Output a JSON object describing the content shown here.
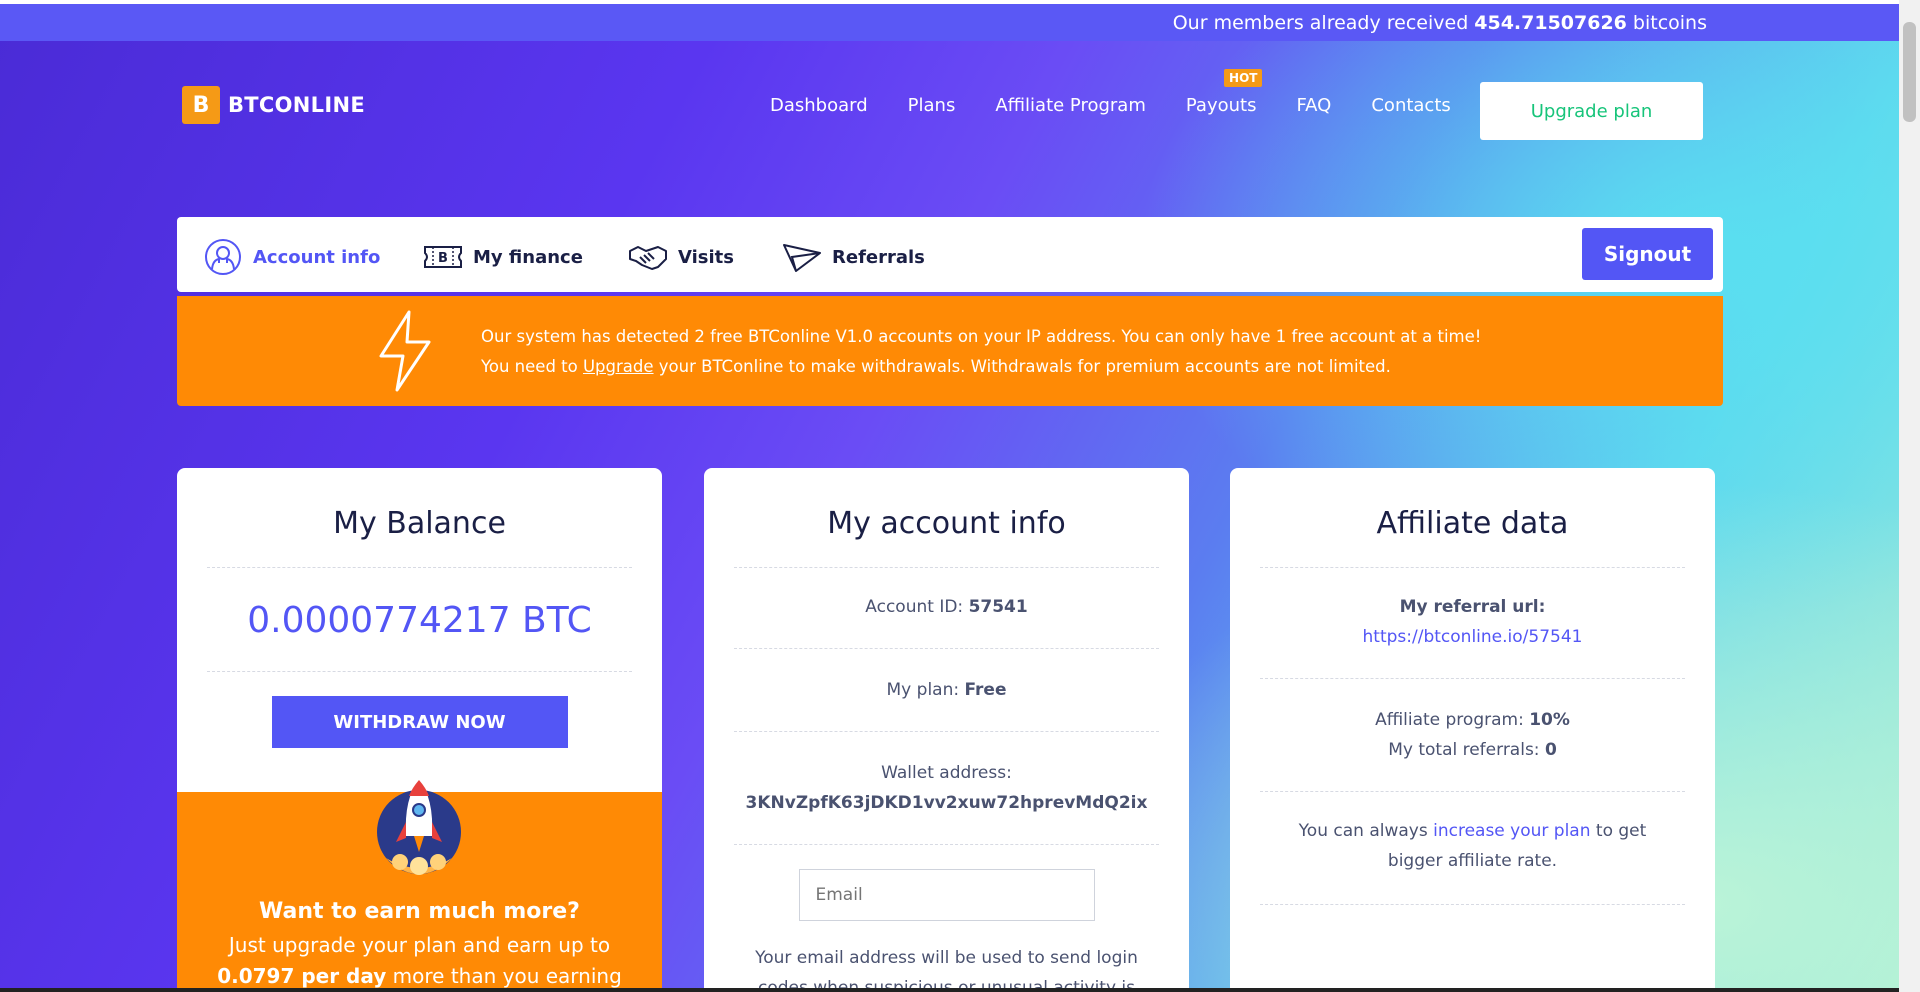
{
  "topbar": {
    "prefix": "Our members already received",
    "amount": "454.71507626",
    "suffix": "bitcoins"
  },
  "brand": {
    "mark": "B",
    "name": "BTCONLINE"
  },
  "nav": {
    "items": [
      "Dashboard",
      "Plans",
      "Affiliate Program",
      "Payouts",
      "FAQ",
      "Contacts"
    ],
    "hot_badge": "HOT",
    "upgrade_label": "Upgrade plan"
  },
  "tabs": {
    "items": [
      "Account info",
      "My finance",
      "Visits",
      "Referrals"
    ],
    "signout_label": "Signout"
  },
  "alert": {
    "line1": "Our system has detected 2 free BTConline V1.0 accounts on your IP address. You can only have 1 free account at a time!",
    "line2_prefix": "You need to",
    "line2_link": "Upgrade",
    "line2_suffix": "your BTConline to make withdrawals. Withdrawals for premium accounts are not limited."
  },
  "balance_card": {
    "title": "My Balance",
    "balance": "0.0000774217 BTC",
    "withdraw_label": "WITHDRAW NOW",
    "promo_title": "Want to earn much more?",
    "promo_prefix": "Just upgrade your plan and earn up to",
    "promo_amount": "0.0797 per day",
    "promo_suffix": "more than you earning now!"
  },
  "account_card": {
    "title": "My account info",
    "account_id_label": "Account ID:",
    "account_id": "57541",
    "plan_label": "My plan:",
    "plan": "Free",
    "wallet_label": "Wallet address:",
    "wallet": "3KNvZpfK63jDKD1vv2xuw72hprevMdQ2ix",
    "email_placeholder": "Email",
    "email_note": "Your email address will be used to send login codes when suspicious or unusual activity is"
  },
  "affiliate_card": {
    "title": "Affiliate data",
    "referral_label": "My referral url:",
    "referral_url": "https://btconline.io/57541",
    "program_label": "Affiliate program:",
    "program_rate": "10%",
    "referrals_label": "My total referrals:",
    "referrals_count": "0",
    "note_prefix": "You can always",
    "note_link": "increase your plan",
    "note_suffix": "to get bigger affiliate rate."
  },
  "colors": {
    "accent": "#5356f5",
    "orange": "#ff8a05",
    "green": "#17c47a"
  }
}
